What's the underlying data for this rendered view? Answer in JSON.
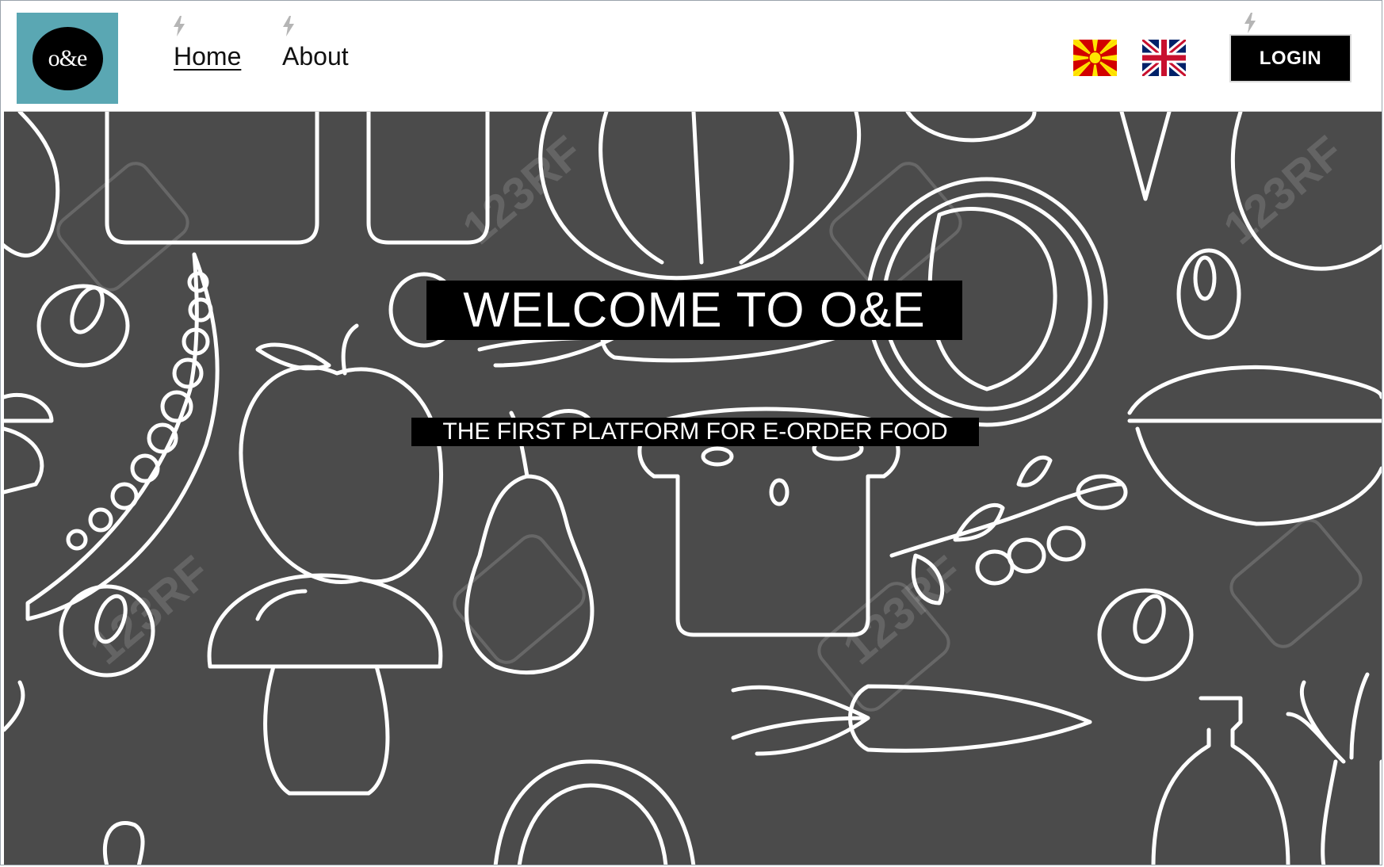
{
  "app": {
    "logo_text": "o&e"
  },
  "nav": {
    "links": [
      {
        "label": "Home",
        "active": true
      },
      {
        "label": "About",
        "active": false
      }
    ],
    "languages": [
      {
        "code": "mk",
        "icon": "macedonia-flag-icon"
      },
      {
        "code": "en",
        "icon": "uk-flag-icon"
      }
    ],
    "login_label": "LOGIN"
  },
  "hero": {
    "title": "WELCOME TO O&E",
    "subtitle": "THE FIRST PLATFORM FOR E-ORDER FOOD",
    "background": "food-doodle-pattern",
    "watermark": "123RF"
  },
  "colors": {
    "logo_bg": "#5aa7b3",
    "hero_bg": "#4b4b4b",
    "text_box_bg": "#000000",
    "login_bg": "#000000"
  }
}
